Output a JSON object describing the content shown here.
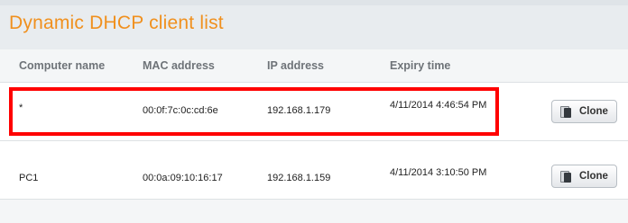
{
  "title": "Dynamic DHCP client list",
  "table": {
    "headers": [
      "Computer name",
      "MAC address",
      "IP address",
      "Expiry time"
    ],
    "rows": [
      {
        "computer_name": "*",
        "mac_address": "00:0f:7c:0c:cd:6e",
        "ip_address": "192.168.1.179",
        "expiry_time": "4/11/2014 4:46:54 PM",
        "action_label": "Clone"
      },
      {
        "computer_name": "PC1",
        "mac_address": "00:0a:09:10:16:17",
        "ip_address": "192.168.1.159",
        "expiry_time": "4/11/2014 3:10:50 PM",
        "action_label": "Clone"
      }
    ]
  },
  "colors": {
    "title": "#f0901e",
    "highlight": "#ff0000"
  },
  "icons": {
    "clone": "clone-icon"
  }
}
